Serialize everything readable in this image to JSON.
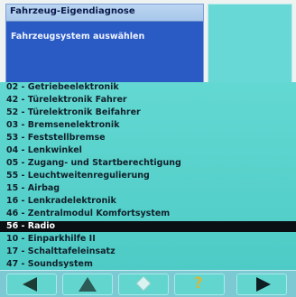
{
  "header": {
    "title": "Fahrzeug-Eigendiagnose",
    "panel_label": "Fahrzeugsystem auswählen"
  },
  "list": {
    "items": [
      {
        "label": "02 - Getriebeelektronik"
      },
      {
        "label": "42 - Türelektronik Fahrer"
      },
      {
        "label": "52 - Türelektronik Beifahrer"
      },
      {
        "label": "03 - Bremsenelektronik"
      },
      {
        "label": "53 - Feststellbremse"
      },
      {
        "label": "04 - Lenkwinkel"
      },
      {
        "label": "05 - Zugang- und Startberechtigung"
      },
      {
        "label": "55 - Leuchtweitenregulierung"
      },
      {
        "label": "15 - Airbag"
      },
      {
        "label": "16 - Lenkradelektronik"
      },
      {
        "label": "46 - Zentralmodul Komfortsystem"
      },
      {
        "label": "56 - Radio",
        "selected": true
      },
      {
        "label": "10 - Einparkhilfe II"
      },
      {
        "label": "17 - Schalttafeleinsatz"
      },
      {
        "label": "47 - Soundsystem"
      }
    ]
  },
  "toolbar": {
    "buttons": [
      {
        "name": "back-button",
        "icon": "arrow-left-icon"
      },
      {
        "name": "up-button",
        "icon": "arrow-up-icon"
      },
      {
        "name": "disabled-button",
        "icon": "diamond-icon"
      },
      {
        "name": "help-button",
        "icon": "help-icon",
        "glyph": "?"
      },
      {
        "name": "forward-button",
        "icon": "arrow-right-icon"
      }
    ]
  },
  "colors": {
    "panel_blue": "#2a5ac4",
    "list_bg": "#5ed4cf",
    "selected_row": "#0a0f14"
  }
}
